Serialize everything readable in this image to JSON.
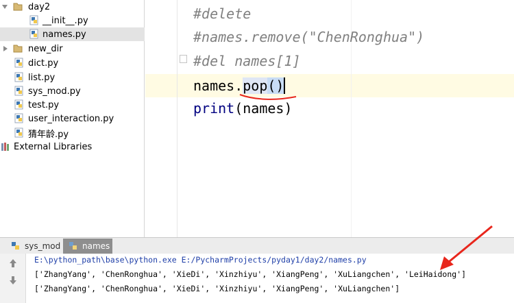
{
  "project_tree": {
    "items": [
      {
        "label": "day2",
        "kind": "folder",
        "expanded": true
      },
      {
        "label": "__init__.py",
        "kind": "python-file"
      },
      {
        "label": "names.py",
        "kind": "python-file",
        "selected": true
      },
      {
        "label": "new_dir",
        "kind": "folder",
        "expanded": false
      },
      {
        "label": "dict.py",
        "kind": "python-file"
      },
      {
        "label": "list.py",
        "kind": "python-file"
      },
      {
        "label": "sys_mod.py",
        "kind": "python-file"
      },
      {
        "label": "test.py",
        "kind": "python-file"
      },
      {
        "label": "user_interaction.py",
        "kind": "python-file"
      },
      {
        "label": "猜年龄.py",
        "kind": "python-file"
      },
      {
        "label": "External Libraries",
        "kind": "libraries"
      }
    ]
  },
  "editor": {
    "lines": [
      {
        "text": "#delete",
        "type": "comment"
      },
      {
        "text": "#names.remove(\"ChenRonghua\")",
        "type": "comment"
      },
      {
        "text": "#del names[1]",
        "type": "comment"
      },
      {
        "text": "names.pop()",
        "type": "code",
        "current": true
      },
      {
        "text": "print(names)",
        "type": "code"
      }
    ],
    "line4": {
      "receiver": "names.",
      "method": "pop",
      "open_paren": "(",
      "close_paren": ")"
    },
    "line5": {
      "func": "print",
      "args": "(names)"
    }
  },
  "run_panel": {
    "tabs": [
      {
        "label": "sys_mod",
        "active": false
      },
      {
        "label": "names",
        "active": true
      }
    ],
    "command": "E:\\python_path\\base\\python.exe E:/PycharmProjects/pyday1/day2/names.py",
    "output_lines": [
      "['ZhangYang', 'ChenRonghua', 'XieDi', 'Xinzhiyu', 'XiangPeng', 'XuLiangchen', 'LeiHaidong']",
      "['ZhangYang', 'ChenRonghua', 'XieDi', 'Xinzhiyu', 'XiangPeng', 'XuLiangchen']"
    ]
  },
  "colors": {
    "annotation_red": "#e8261c",
    "comment_gray": "#808080",
    "current_line": "#fffbe3",
    "selection_blue": "#c8dcf5",
    "console_command": "#1f3fa8"
  }
}
